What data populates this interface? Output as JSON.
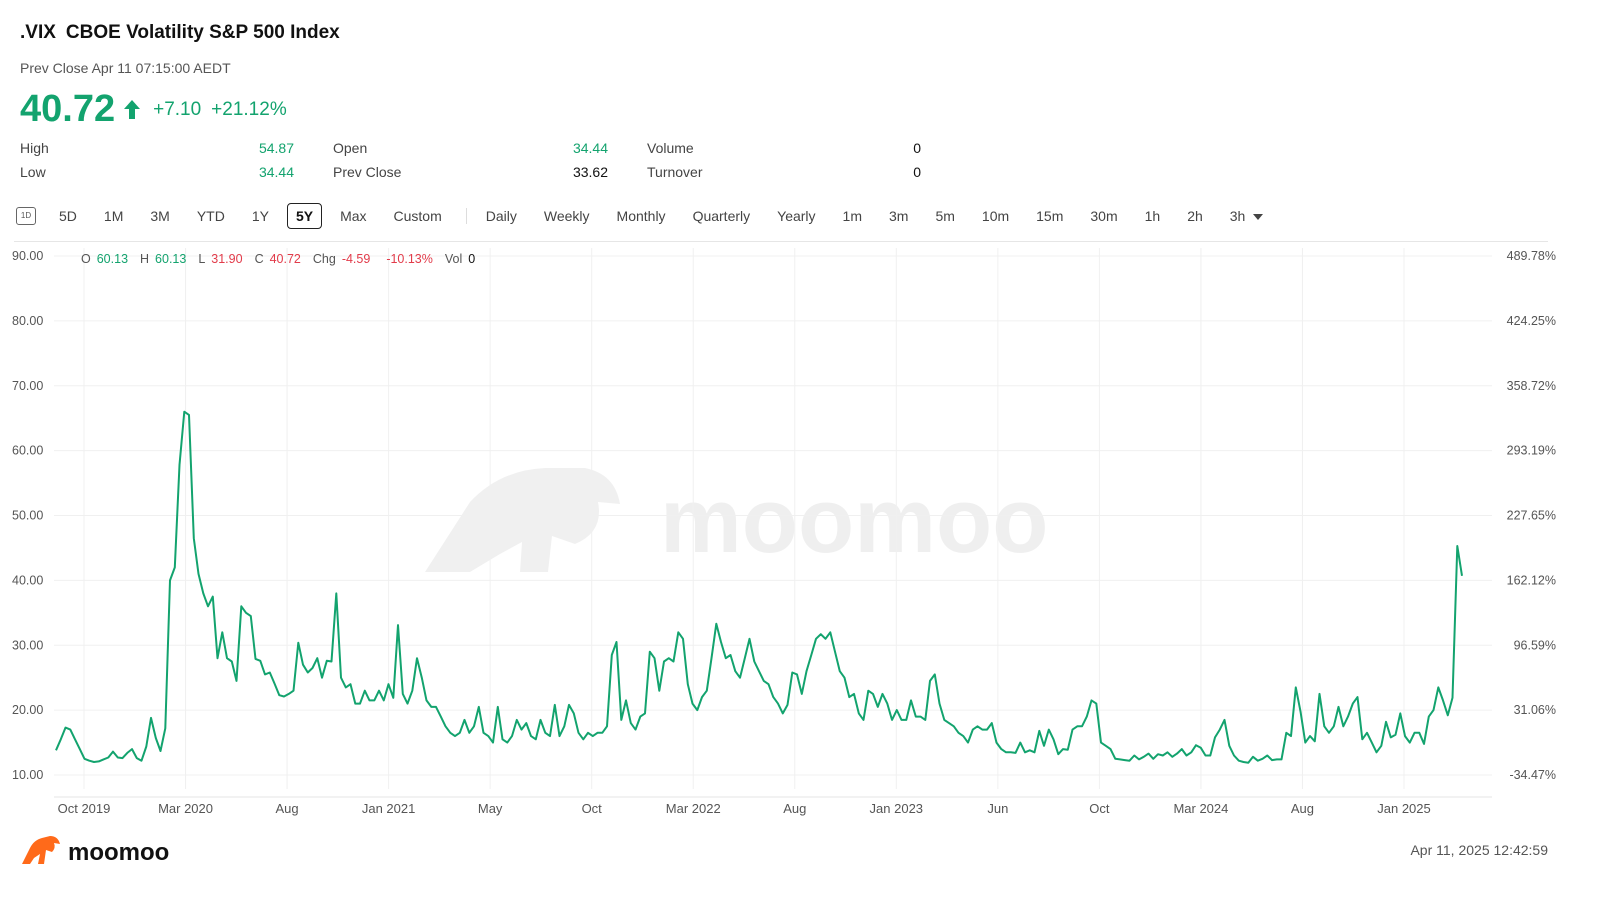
{
  "header": {
    "symbol": ".VIX",
    "name": "CBOE Volatility S&P 500 Index",
    "subtitle": "Prev Close Apr 11 07:15:00 AEDT",
    "price": "40.72",
    "change": "+7.10",
    "change_pct": "+21.12%"
  },
  "stats": {
    "high_label": "High",
    "high": "54.87",
    "low_label": "Low",
    "low": "34.44",
    "open_label": "Open",
    "open": "34.44",
    "prev_close_label": "Prev Close",
    "prev_close": "33.62",
    "volume_label": "Volume",
    "volume": "0",
    "turnover_label": "Turnover",
    "turnover": "0"
  },
  "toolbar": {
    "periods": [
      "5D",
      "1M",
      "3M",
      "YTD",
      "1Y",
      "5Y",
      "Max",
      "Custom"
    ],
    "active_period": "5Y",
    "intervals": [
      "Daily",
      "Weekly",
      "Monthly",
      "Quarterly",
      "Yearly",
      "1m",
      "3m",
      "5m",
      "10m",
      "15m",
      "30m",
      "1h",
      "2h",
      "3h"
    ],
    "d1_icon": "1D"
  },
  "ohlc": {
    "o_label": "O",
    "o": "60.13",
    "h_label": "H",
    "h": "60.13",
    "l_label": "L",
    "l": "31.90",
    "c_label": "C",
    "c": "40.72",
    "chg_label": "Chg",
    "chg": "-4.59",
    "chg_pct": "-10.13%",
    "vol_label": "Vol",
    "vol": "0"
  },
  "footer": {
    "logo_text": "moomoo",
    "timestamp": "Apr 11, 2025 12:42:59"
  },
  "watermark": "moomoo",
  "colors": {
    "line": "#13a36e",
    "up": "#13a36e",
    "down": "#e23b4a"
  },
  "chart_data": {
    "type": "line",
    "ylim": [
      10,
      90
    ],
    "y_ticks": [
      "90.00",
      "80.00",
      "70.00",
      "60.00",
      "50.00",
      "40.00",
      "30.00",
      "20.00",
      "10.00"
    ],
    "y2_ticks": [
      "489.78%",
      "424.25%",
      "358.72%",
      "293.19%",
      "227.65%",
      "162.12%",
      "96.59%",
      "31.06%",
      "-34.47%"
    ],
    "x_ticks": [
      "Oct 2019",
      "Mar 2020",
      "Aug",
      "Jan 2021",
      "May",
      "Oct",
      "Mar 2022",
      "Aug",
      "Jan 2023",
      "Jun",
      "Oct",
      "Mar 2024",
      "Aug",
      "Jan 2025"
    ],
    "series": [
      {
        "values": [
          13.8,
          15.5,
          17.3,
          17.0,
          15.5,
          14.0,
          12.5,
          12.2,
          12.0,
          12.1,
          12.4,
          12.7,
          13.6,
          12.7,
          12.6,
          13.4,
          14.0,
          12.6,
          12.2,
          14.4,
          18.8,
          15.7,
          13.7,
          17.2,
          40.0,
          42.0,
          57.8,
          66.0,
          65.5,
          46.5,
          41.0,
          38.0,
          36.0,
          37.5,
          28.0,
          32.0,
          28.0,
          27.5,
          24.5,
          36.0,
          35.0,
          34.5,
          27.9,
          27.6,
          25.5,
          25.8,
          24.1,
          22.3,
          22.1,
          22.5,
          23.0,
          30.4,
          27.0,
          25.8,
          26.5,
          28.0,
          25.0,
          27.6,
          27.5,
          38.0,
          25.0,
          23.5,
          24.0,
          21.0,
          21.0,
          23.0,
          21.5,
          21.5,
          23.0,
          21.5,
          24.0,
          21.9,
          33.1,
          22.5,
          21.0,
          23.0,
          28.0,
          25.0,
          21.5,
          20.5,
          20.5,
          19.0,
          17.5,
          16.5,
          16.0,
          16.5,
          18.5,
          16.5,
          17.5,
          20.5,
          16.5,
          16.0,
          15.0,
          20.5,
          15.5,
          15.0,
          16.0,
          18.5,
          17.0,
          18.0,
          16.0,
          15.5,
          18.5,
          16.5,
          16.0,
          20.8,
          16.0,
          17.5,
          20.8,
          19.5,
          16.5,
          15.5,
          16.5,
          16.0,
          16.5,
          16.5,
          17.5,
          28.5,
          30.5,
          18.5,
          21.5,
          18.0,
          17.0,
          19.0,
          19.5,
          29.0,
          28.0,
          23.0,
          27.5,
          28.0,
          27.5,
          32.0,
          31.0,
          24.0,
          21.0,
          20.0,
          22.0,
          23.0,
          28.0,
          33.3,
          30.5,
          28.0,
          28.5,
          26.0,
          25.0,
          28.0,
          31.0,
          27.5,
          26.0,
          24.5,
          24.0,
          22.0,
          21.0,
          19.5,
          20.8,
          25.8,
          25.5,
          22.5,
          26.0,
          28.5,
          31.0,
          31.7,
          31.0,
          32.0,
          29.0,
          26.0,
          25.0,
          22.0,
          22.5,
          19.5,
          18.5,
          23.0,
          22.5,
          20.5,
          22.5,
          21.0,
          18.5,
          20.0,
          18.5,
          18.5,
          21.5,
          19.0,
          19.0,
          18.5,
          24.5,
          25.5,
          21.0,
          18.5,
          18.0,
          17.5,
          16.5,
          16.0,
          15.0,
          17.0,
          17.5,
          17.0,
          17.0,
          18.0,
          15.0,
          14.0,
          13.5,
          13.5,
          13.4,
          15.0,
          13.5,
          13.8,
          13.5,
          16.8,
          14.5,
          17.0,
          15.5,
          13.2,
          14.0,
          13.9,
          17.0,
          17.5,
          17.5,
          19.0,
          21.5,
          21.0,
          15.0,
          14.5,
          14.0,
          12.5,
          12.4,
          12.3,
          12.2,
          13.0,
          12.4,
          12.8,
          13.3,
          12.5,
          13.2,
          13.0,
          13.5,
          12.8,
          13.3,
          14.0,
          13.0,
          13.5,
          14.6,
          14.2,
          13.0,
          13.0,
          15.8,
          17.0,
          18.5,
          14.5,
          13.0,
          12.2,
          12.0,
          11.9,
          12.8,
          12.2,
          12.5,
          13.0,
          12.3,
          12.4,
          12.4,
          16.5,
          16.0,
          23.5,
          19.8,
          15.0,
          16.0,
          15.2,
          22.5,
          17.5,
          16.5,
          17.5,
          20.5,
          17.5,
          19.0,
          21.0,
          22.0,
          15.5,
          16.5,
          15.0,
          13.5,
          14.5,
          18.2,
          15.8,
          16.2,
          19.5,
          16.0,
          15.0,
          16.5,
          16.5,
          14.8,
          19.0,
          20.0,
          23.5,
          21.5,
          19.2,
          21.9,
          45.3,
          40.7
        ]
      }
    ]
  }
}
